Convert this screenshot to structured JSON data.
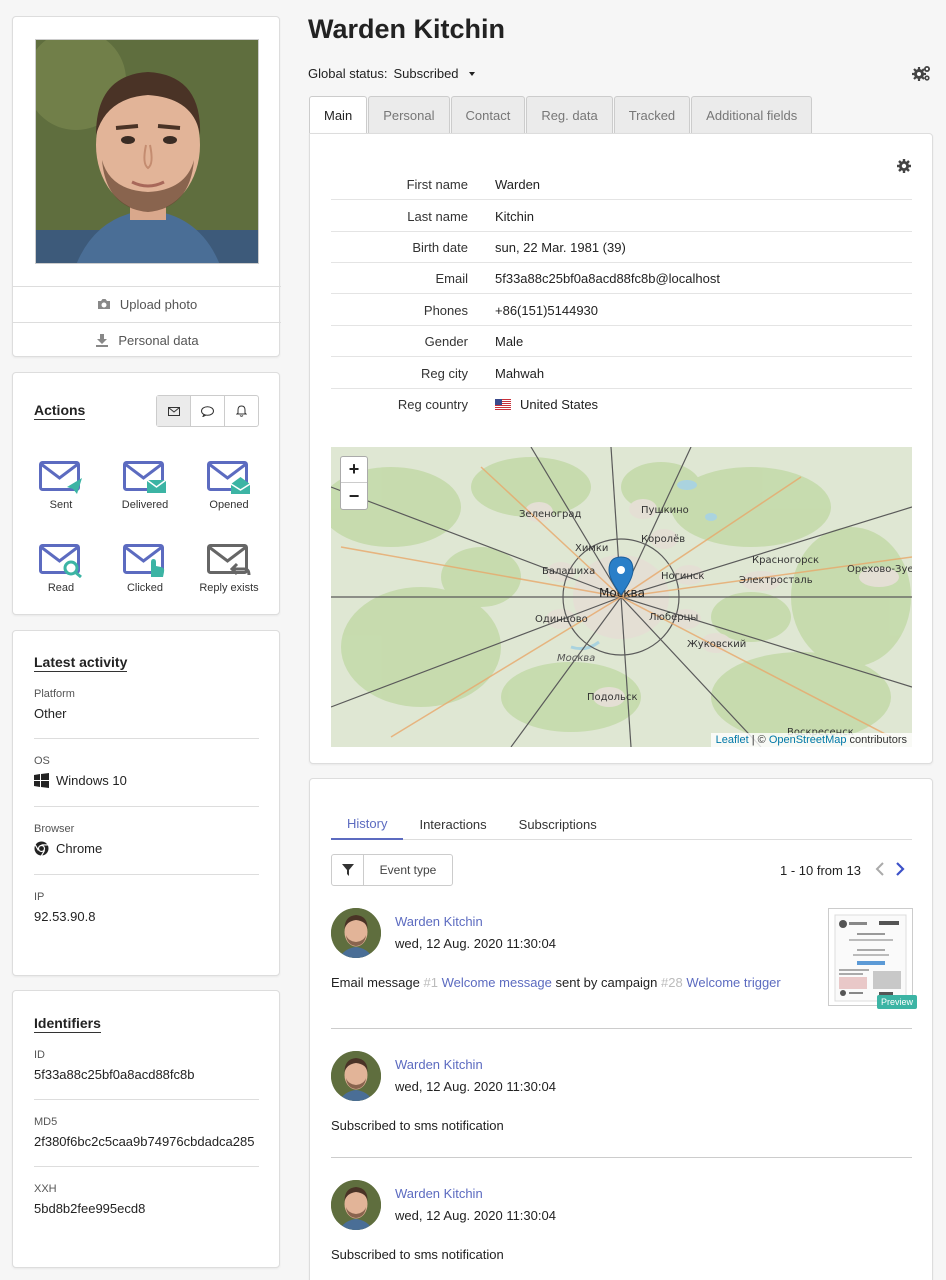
{
  "profile": {
    "name": "Warden Kitchin",
    "upload_photo_label": "Upload photo",
    "personal_data_label": "Personal data"
  },
  "actions": {
    "title": "Actions",
    "channel_icons": [
      "envelope-icon",
      "chat-bubble-icon",
      "bell-icon"
    ],
    "items": [
      {
        "label": "Sent",
        "icon": "mail-sent-icon"
      },
      {
        "label": "Delivered",
        "icon": "mail-delivered-icon"
      },
      {
        "label": "Opened",
        "icon": "mail-opened-icon"
      },
      {
        "label": "Read",
        "icon": "mail-read-icon"
      },
      {
        "label": "Clicked",
        "icon": "mail-clicked-icon"
      },
      {
        "label": "Reply exists",
        "icon": "mail-reply-icon"
      }
    ],
    "accent_color": "#5c6bc0",
    "status_color": "#3cb4a4"
  },
  "latest_activity": {
    "title": "Latest activity",
    "platform": {
      "label": "Platform",
      "value": "Other"
    },
    "os": {
      "label": "OS",
      "value": "Windows 10",
      "icon": "windows-icon"
    },
    "browser": {
      "label": "Browser",
      "value": "Chrome",
      "icon": "chrome-icon"
    },
    "ip": {
      "label": "IP",
      "value": "92.53.90.8"
    }
  },
  "identifiers": {
    "title": "Identifiers",
    "id": {
      "label": "ID",
      "value": "5f33a88c25bf0a8acd88fc8b"
    },
    "md5": {
      "label": "MD5",
      "value": "2f380f6bc2c5caa9b74976cbdadca285"
    },
    "xxh": {
      "label": "XXH",
      "value": "5bd8b2fee995ecd8"
    }
  },
  "header": {
    "title": "Warden Kitchin",
    "global_status_label": "Global status:",
    "global_status_value": "Subscribed"
  },
  "tabs": [
    "Main",
    "Personal",
    "Contact",
    "Reg. data",
    "Tracked",
    "Additional fields"
  ],
  "main_info": [
    {
      "key": "First name",
      "value": "Warden"
    },
    {
      "key": "Last name",
      "value": "Kitchin"
    },
    {
      "key": "Birth date",
      "value": "sun, 22 Mar. 1981 (39)"
    },
    {
      "key": "Email",
      "value": "5f33a88c25bf0a8acd88fc8b@localhost"
    },
    {
      "key": "Phones",
      "value": "+86(151)5144930"
    },
    {
      "key": "Gender",
      "value": "Male"
    },
    {
      "key": "Reg city",
      "value": "Mahwah"
    },
    {
      "key": "Reg country",
      "value": "United States"
    }
  ],
  "map": {
    "zoom_in": "+",
    "zoom_out": "−",
    "attribution_leaflet": "Leaflet",
    "attribution_sep": " | © ",
    "attribution_osm": "OpenStreetMap",
    "attribution_tail": " contributors",
    "labels": [
      "Зеленоград",
      "Пушкино",
      "Королёв",
      "Химки",
      "Красногорск",
      "Балашиха",
      "Ногинск",
      "Электросталь",
      "Орехово-Зуево",
      "Москва",
      "Одинцово",
      "Люберцы",
      "Жуковский",
      "Москва",
      "Подольск",
      "Воскресенск"
    ]
  },
  "history": {
    "tabs": [
      "History",
      "Interactions",
      "Subscriptions"
    ],
    "filter_label": "Event type",
    "pager_text": "1 - 10 from 13",
    "preview_label": "Preview",
    "events": [
      {
        "name": "Warden Kitchin",
        "date": "wed, 12 Aug. 2020 11:30:04",
        "text_prefix": "Email message ",
        "ref1": "#1",
        "link1": "Welcome message",
        "text_mid": " sent by campaign ",
        "ref2": "#28",
        "link2": "Welcome trigger"
      },
      {
        "name": "Warden Kitchin",
        "date": "wed, 12 Aug. 2020 11:30:04",
        "text": "Subscribed to sms notification"
      },
      {
        "name": "Warden Kitchin",
        "date": "wed, 12 Aug. 2020 11:30:04",
        "text": "Subscribed to sms notification"
      }
    ]
  }
}
